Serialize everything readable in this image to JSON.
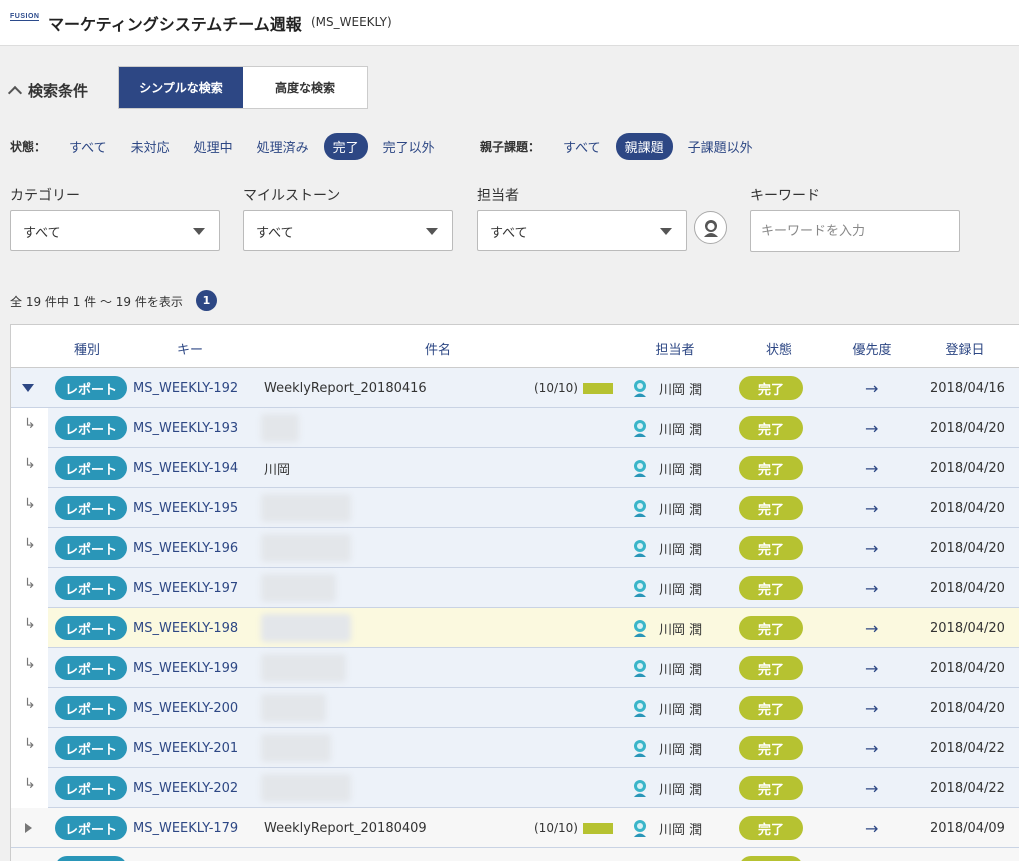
{
  "header": {
    "logo": "FUSION",
    "title": "マーケティングシステムチーム週報",
    "key": "(MS_WEEKLY)"
  },
  "search": {
    "toggle_label": "検索条件",
    "tabs": [
      "シンプルな検索",
      "高度な検索"
    ],
    "status_label": "状態：",
    "status_options": [
      "すべて",
      "未対応",
      "処理中",
      "処理済み",
      "完了",
      "完了以外"
    ],
    "parent_label": "親子課題：",
    "parent_options": [
      "すべて",
      "親課題",
      "子課題以外"
    ],
    "category_label": "カテゴリー",
    "category_value": "すべて",
    "milestone_label": "マイルストーン",
    "milestone_value": "すべて",
    "assignee_label": "担当者",
    "assignee_value": "すべて",
    "keyword_label": "キーワード",
    "keyword_placeholder": "キーワードを入力"
  },
  "result": {
    "count_text": "全 19 件中 1 件 ～ 19 件を表示",
    "page": "1"
  },
  "table": {
    "headers": [
      "種別",
      "キー",
      "件名",
      "担当者",
      "状態",
      "優先度",
      "登録日"
    ],
    "rows": [
      {
        "kind": "parent",
        "type": "レポート",
        "key": "MS_WEEKLY-192",
        "summary": "WeeklyReport_20180416",
        "progress": "(10/10)",
        "assignee": "川岡 潤",
        "status": "完了",
        "priority": "→",
        "date": "2018/04/16"
      },
      {
        "kind": "child",
        "type": "レポート",
        "key": "MS_WEEKLY-193",
        "summary": "",
        "assignee": "川岡 潤",
        "status": "完了",
        "priority": "→",
        "date": "2018/04/20"
      },
      {
        "kind": "child",
        "type": "レポート",
        "key": "MS_WEEKLY-194",
        "summary": "川岡",
        "assignee": "川岡 潤",
        "status": "完了",
        "priority": "→",
        "date": "2018/04/20"
      },
      {
        "kind": "child",
        "type": "レポート",
        "key": "MS_WEEKLY-195",
        "summary": "",
        "assignee": "川岡 潤",
        "status": "完了",
        "priority": "→",
        "date": "2018/04/20"
      },
      {
        "kind": "child",
        "type": "レポート",
        "key": "MS_WEEKLY-196",
        "summary": "",
        "assignee": "川岡 潤",
        "status": "完了",
        "priority": "→",
        "date": "2018/04/20"
      },
      {
        "kind": "child",
        "type": "レポート",
        "key": "MS_WEEKLY-197",
        "summary": "",
        "assignee": "川岡 潤",
        "status": "完了",
        "priority": "→",
        "date": "2018/04/20"
      },
      {
        "kind": "child",
        "type": "レポート",
        "key": "MS_WEEKLY-198",
        "summary": "",
        "assignee": "川岡 潤",
        "status": "完了",
        "priority": "→",
        "date": "2018/04/20"
      },
      {
        "kind": "child",
        "type": "レポート",
        "key": "MS_WEEKLY-199",
        "summary": "",
        "assignee": "川岡 潤",
        "status": "完了",
        "priority": "→",
        "date": "2018/04/20"
      },
      {
        "kind": "child",
        "type": "レポート",
        "key": "MS_WEEKLY-200",
        "summary": "",
        "assignee": "川岡 潤",
        "status": "完了",
        "priority": "→",
        "date": "2018/04/20"
      },
      {
        "kind": "child",
        "type": "レポート",
        "key": "MS_WEEKLY-201",
        "summary": "",
        "assignee": "川岡 潤",
        "status": "完了",
        "priority": "→",
        "date": "2018/04/22"
      },
      {
        "kind": "child",
        "type": "レポート",
        "key": "MS_WEEKLY-202",
        "summary": "",
        "assignee": "川岡 潤",
        "status": "完了",
        "priority": "→",
        "date": "2018/04/22"
      },
      {
        "kind": "parent-collapsed",
        "type": "レポート",
        "key": "MS_WEEKLY-179",
        "summary": "WeeklyReport_20180409",
        "progress": "(10/10)",
        "assignee": "川岡 潤",
        "status": "完了",
        "priority": "→",
        "date": "2018/04/09"
      },
      {
        "kind": "parent-collapsed",
        "type": "レポート",
        "key": "",
        "summary": "",
        "assignee": "",
        "status": "完了",
        "priority": "",
        "date": ""
      }
    ]
  },
  "colors": {
    "primary": "#2d4784",
    "type_badge": "#2a96b8",
    "status_done": "#b6c231",
    "row_bg": "#edf2f9",
    "row_highlight": "#fbf9df"
  }
}
